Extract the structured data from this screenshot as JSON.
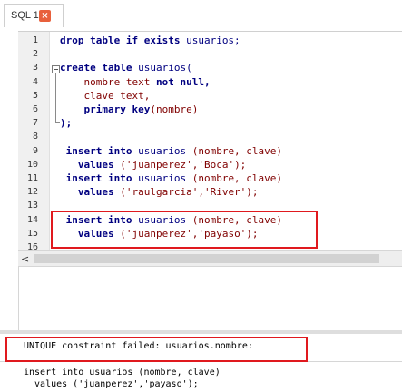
{
  "tab": {
    "label": "SQL 1",
    "close_glyph": "×"
  },
  "editor": {
    "lines": [
      {
        "n": "1",
        "tokens": [
          {
            "t": "drop table if exists ",
            "c": "kw"
          },
          {
            "t": "usuarios;",
            "c": "id"
          }
        ]
      },
      {
        "n": "2",
        "tokens": []
      },
      {
        "n": "3",
        "tokens": [
          {
            "t": "create table ",
            "c": "kw"
          },
          {
            "t": "usuarios(",
            "c": "id"
          }
        ]
      },
      {
        "n": "4",
        "tokens": [
          {
            "t": "    nombre text ",
            "c": "col"
          },
          {
            "t": "not null,",
            "c": "kw"
          }
        ]
      },
      {
        "n": "5",
        "tokens": [
          {
            "t": "    clave text,",
            "c": "col"
          }
        ]
      },
      {
        "n": "6",
        "tokens": [
          {
            "t": "    primary key",
            "c": "kw"
          },
          {
            "t": "(nombre)",
            "c": "col"
          }
        ]
      },
      {
        "n": "7",
        "tokens": [
          {
            "t": ");",
            "c": "kw"
          }
        ]
      },
      {
        "n": "8",
        "tokens": []
      },
      {
        "n": "9",
        "tokens": [
          {
            "t": " insert into ",
            "c": "kw"
          },
          {
            "t": "usuarios ",
            "c": "id"
          },
          {
            "t": "(nombre, clave)",
            "c": "col"
          }
        ]
      },
      {
        "n": "10",
        "tokens": [
          {
            "t": "   values ",
            "c": "kw"
          },
          {
            "t": "('juanperez','Boca');",
            "c": "str"
          }
        ]
      },
      {
        "n": "11",
        "tokens": [
          {
            "t": " insert into ",
            "c": "kw"
          },
          {
            "t": "usuarios ",
            "c": "id"
          },
          {
            "t": "(nombre, clave)",
            "c": "col"
          }
        ]
      },
      {
        "n": "12",
        "tokens": [
          {
            "t": "   values ",
            "c": "kw"
          },
          {
            "t": "('raulgarcia','River');",
            "c": "str"
          }
        ]
      },
      {
        "n": "13",
        "tokens": []
      },
      {
        "n": "14",
        "tokens": [
          {
            "t": " insert into ",
            "c": "kw"
          },
          {
            "t": "usuarios ",
            "c": "id"
          },
          {
            "t": "(nombre, clave)",
            "c": "col"
          }
        ]
      },
      {
        "n": "15",
        "tokens": [
          {
            "t": "   values ",
            "c": "kw"
          },
          {
            "t": "('juanperez','payaso');",
            "c": "str"
          }
        ]
      },
      {
        "n": "16",
        "tokens": []
      }
    ]
  },
  "scrollbar": {
    "left_arrow": "<"
  },
  "messages": {
    "error": "UNIQUE constraint failed: usuarios.nombre:",
    "query_line1": "insert into usuarios (nombre, clave)",
    "query_line2": "  values ('juanperez','payaso');"
  },
  "colors": {
    "highlight": "#e0191e",
    "keyword": "#000080",
    "string": "#800000"
  }
}
